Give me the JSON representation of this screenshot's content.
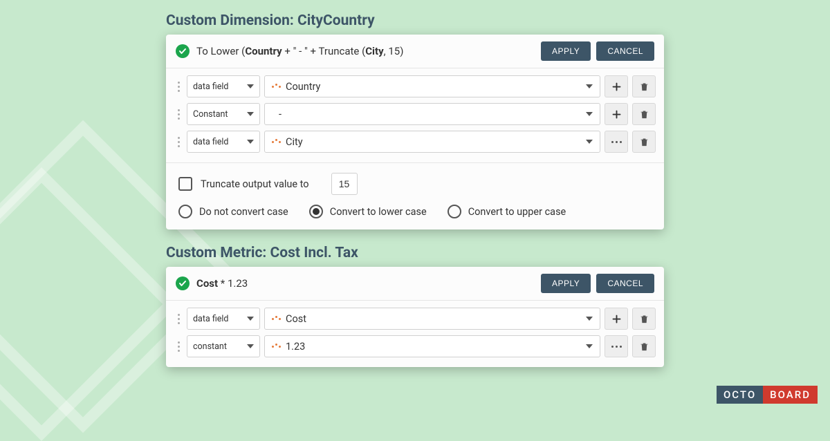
{
  "section1": {
    "title": "Custom Dimension: CityCountry",
    "expression_prefix": "To Lower (",
    "expression_b1": "Country",
    "expression_mid1": " + \" - \" + Truncate (",
    "expression_b2": "City",
    "expression_suffix": ", 15)",
    "apply": "APPLY",
    "cancel": "CANCEL",
    "rows": [
      {
        "type": "data field",
        "value": "Country",
        "icon": true,
        "action": "plus"
      },
      {
        "type": "Constant",
        "value": "-",
        "icon": false,
        "action": "plus"
      },
      {
        "type": "data field",
        "value": "City",
        "icon": true,
        "action": "more"
      }
    ],
    "truncate_label": "Truncate output value to",
    "truncate_value": "15",
    "radio_noconvert": "Do not convert case",
    "radio_lower": "Convert to lower case",
    "radio_upper": "Convert to upper case"
  },
  "section2": {
    "title": "Custom Metric: Cost Incl. Tax",
    "expression_b1": "Cost",
    "expression_rest": " * 1.23",
    "apply": "APPLY",
    "cancel": "CANCEL",
    "rows": [
      {
        "type": "data field",
        "value": "Cost",
        "icon": true,
        "action": "plus"
      },
      {
        "type": "constant",
        "value": "1.23",
        "icon": true,
        "action": "more"
      }
    ]
  },
  "logo": {
    "part1": "OCTO",
    "part2": "BOARD"
  }
}
